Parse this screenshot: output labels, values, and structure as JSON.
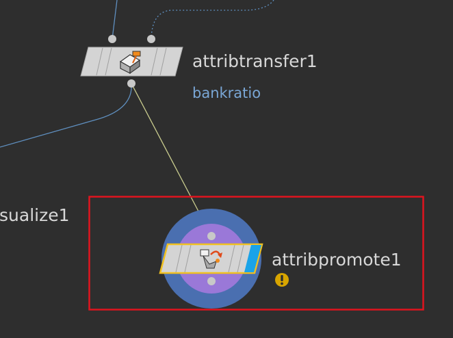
{
  "network": {
    "nodes": [
      {
        "name": "attribtransfer1",
        "comment": "bankratio",
        "type_icon": "attribtransfer-icon"
      },
      {
        "name": "attribpromote1",
        "type_icon": "attribpromote-icon",
        "status": "warning",
        "warning_icon": "exclamation-warning-icon",
        "selected": true,
        "display_flag": true
      }
    ],
    "offscreen_node_label": "sualize1"
  },
  "colors": {
    "background": "#2e2e2e",
    "wire_blue": "#5f8fbf",
    "wire_selected": "#c9cc8e",
    "node_body": "#d4d4d4",
    "selection_outline": "#f0c020",
    "display_flag": "#1aa3e8",
    "highlight_ring_outer": "#4a6fb0",
    "highlight_ring_inner": "#9a78d8",
    "warning": "#d8a500",
    "annotation_box": "#e0141e"
  }
}
